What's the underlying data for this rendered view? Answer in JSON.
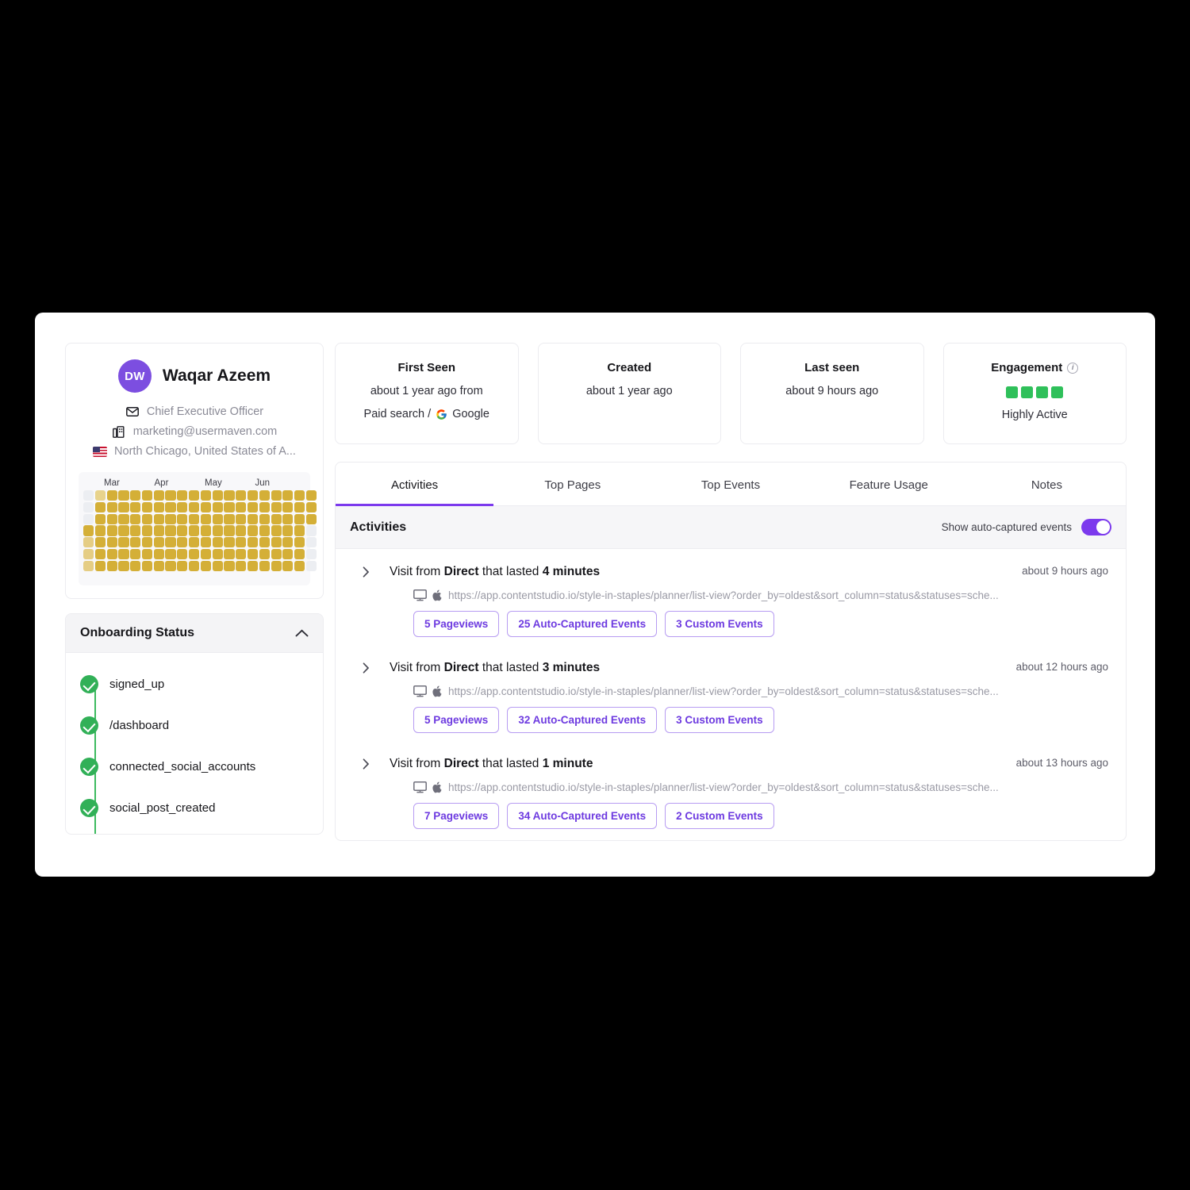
{
  "profile": {
    "avatar_initials": "DW",
    "avatar_color": "#7c4ee0",
    "name": "Waqar Azeem",
    "role": "Chief Executive Officer",
    "email": "marketing@usermaven.com",
    "location": "North Chicago, United States of A...",
    "role_icon": "envelope-icon",
    "email_icon": "building-icon",
    "location_icon": "us-flag-icon"
  },
  "heatmap": {
    "months": [
      "Mar",
      "Apr",
      "May",
      "Jun"
    ],
    "columns": 20,
    "rows": 7,
    "base_color": "#d4af37",
    "empty_color": "#eceef2",
    "cells": [
      [
        0,
        1,
        3,
        3,
        3,
        3,
        3,
        3,
        3,
        3,
        3,
        3,
        3,
        3,
        3,
        3,
        3,
        3,
        3,
        3
      ],
      [
        0,
        3,
        3,
        3,
        3,
        3,
        3,
        3,
        3,
        3,
        3,
        3,
        3,
        3,
        3,
        3,
        3,
        3,
        3,
        3
      ],
      [
        0,
        3,
        3,
        3,
        3,
        3,
        3,
        3,
        3,
        3,
        3,
        3,
        3,
        3,
        3,
        3,
        3,
        3,
        3,
        3
      ],
      [
        3,
        3,
        3,
        3,
        3,
        3,
        3,
        3,
        3,
        3,
        3,
        3,
        3,
        3,
        3,
        3,
        3,
        3,
        3,
        0
      ],
      [
        2,
        3,
        3,
        3,
        3,
        3,
        3,
        3,
        3,
        3,
        3,
        3,
        3,
        3,
        3,
        3,
        3,
        3,
        3,
        0
      ],
      [
        2,
        3,
        3,
        3,
        3,
        3,
        3,
        3,
        3,
        3,
        3,
        3,
        3,
        3,
        3,
        3,
        3,
        3,
        3,
        0
      ],
      [
        2,
        3,
        3,
        3,
        3,
        3,
        3,
        3,
        3,
        3,
        3,
        3,
        3,
        3,
        3,
        3,
        3,
        3,
        3,
        0
      ]
    ]
  },
  "onboarding": {
    "title": "Onboarding Status",
    "collapse_icon": "chevron-up-icon",
    "steps": [
      {
        "label": "signed_up",
        "completed": true
      },
      {
        "label": "/dashboard",
        "completed": true
      },
      {
        "label": "connected_social_accounts",
        "completed": true
      },
      {
        "label": "social_post_created",
        "completed": true
      }
    ]
  },
  "metrics": [
    {
      "title": "First Seen",
      "value": "about 1 year ago from",
      "source_prefix": "Paid search /",
      "source_name": "Google",
      "source_icon": "google-icon",
      "has_info": false
    },
    {
      "title": "Created",
      "value": "about 1 year ago",
      "has_info": false
    },
    {
      "title": "Last seen",
      "value": "about 9 hours ago",
      "has_info": false
    },
    {
      "title": "Engagement",
      "value": "Highly Active",
      "has_info": true,
      "info_icon": "info-icon",
      "engagement_level": 4,
      "engagement_max": 4,
      "engagement_color": "#2fc05a"
    }
  ],
  "tabs": [
    {
      "label": "Activities",
      "active": true
    },
    {
      "label": "Top Pages",
      "active": false
    },
    {
      "label": "Top Events",
      "active": false
    },
    {
      "label": "Feature Usage",
      "active": false
    },
    {
      "label": "Notes",
      "active": false
    }
  ],
  "activities_panel": {
    "title": "Activities",
    "toggle_label": "Show auto-captured events",
    "toggle_on": true,
    "accent_color": "#7c3aed"
  },
  "activities": [
    {
      "caret_icon": "chevron-right-icon",
      "prefix": "Visit from",
      "source": "Direct",
      "middle": "that lasted",
      "duration": "4 minutes",
      "time": "about 9 hours ago",
      "device_icon": "desktop-icon",
      "os_icon": "apple-icon",
      "url": "https://app.contentstudio.io/style-in-staples/planner/list-view?order_by=oldest&sort_column=status&statuses=sche...",
      "chips": [
        "5 Pageviews",
        "25 Auto-Captured Events",
        "3 Custom Events"
      ]
    },
    {
      "caret_icon": "chevron-right-icon",
      "prefix": "Visit from",
      "source": "Direct",
      "middle": "that lasted",
      "duration": "3 minutes",
      "time": "about 12 hours ago",
      "device_icon": "desktop-icon",
      "os_icon": "apple-icon",
      "url": "https://app.contentstudio.io/style-in-staples/planner/list-view?order_by=oldest&sort_column=status&statuses=sche...",
      "chips": [
        "5 Pageviews",
        "32 Auto-Captured Events",
        "3 Custom Events"
      ]
    },
    {
      "caret_icon": "chevron-right-icon",
      "prefix": "Visit from",
      "source": "Direct",
      "middle": "that lasted",
      "duration": "1 minute",
      "time": "about 13 hours ago",
      "device_icon": "desktop-icon",
      "os_icon": "apple-icon",
      "url": "https://app.contentstudio.io/style-in-staples/planner/list-view?order_by=oldest&sort_column=status&statuses=sche...",
      "chips": [
        "7 Pageviews",
        "34 Auto-Captured Events",
        "2 Custom Events"
      ]
    }
  ]
}
